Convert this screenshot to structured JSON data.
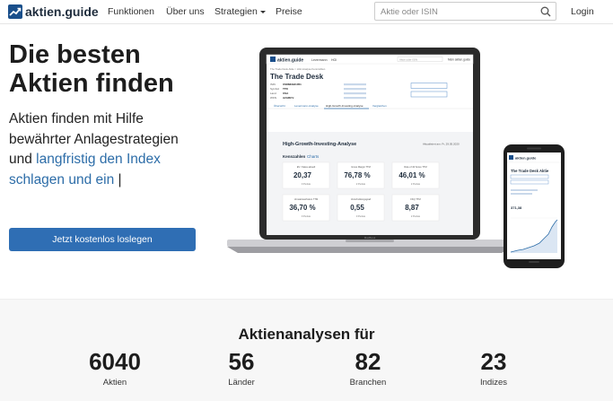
{
  "brand": {
    "name": "aktien.guide"
  },
  "nav": {
    "items": [
      {
        "label": "Funktionen"
      },
      {
        "label": "Über uns"
      },
      {
        "label": "Strategien"
      },
      {
        "label": "Preise"
      }
    ],
    "search_placeholder": "Aktie oder ISIN",
    "login": "Login"
  },
  "hero": {
    "title_line1": "Die besten",
    "title_line2": "Aktien finden",
    "sub_line1": "Aktien finden mit Hilfe",
    "sub_line2": "bewährter Anlagestrategien",
    "sub_line3a": "und ",
    "sub_line3b": "langfristig den Index",
    "sub_line4a": "schlagen und ein",
    "sub_line4b": " |",
    "cta": "Jetzt kostenlos loslegen"
  },
  "mockup": {
    "laptop": {
      "brand": "aktien.guide",
      "menu": [
        "Levermann",
        "HGI"
      ],
      "search": "Aktie oder ISIN",
      "account": "Mein aktien.guide",
      "breadcrumb": "The Trade Desk Aktie > HGI-Analyse Kennzahlen",
      "company": "The Trade Desk",
      "info_labels": [
        "ISIN",
        "Symbol",
        "Land",
        "WKN"
      ],
      "info_values": [
        "US88339J1051",
        "TTD",
        "USA",
        "A2ARCV"
      ],
      "tabs": [
        "Übersicht",
        "Levermann-Analyse",
        "High-Growth-Investing-Analyse",
        "Vergleichen"
      ],
      "section_title": "High-Growth-Investing-Analyse",
      "updated": "Aktualisiert am: Fr, 29.05.2020",
      "kennzahlen": "Kennzahlen",
      "charts": "Charts",
      "brand_label": "MacBook",
      "cards": [
        {
          "label": "EV / Sales aktuell",
          "value": "20,37",
          "points": "0 Punkte"
        },
        {
          "label": "Gross Margin TTM",
          "value": "76,78 %",
          "points": "2 Punkte"
        },
        {
          "label": "Rule of 40 Score TTM",
          "value": "46,01 %",
          "points": "2 Punkte"
        },
        {
          "label": "Umsatzwachstum TTM",
          "value": "36,70 %",
          "points": "0 Punkte"
        },
        {
          "label": "Verschuldungsgrad",
          "value": "0,55",
          "points": "0 Punkte"
        },
        {
          "label": "FKQ TTM",
          "value": "8,87",
          "points": "2 Punkte"
        }
      ]
    },
    "phone": {
      "brand": "aktien.guide",
      "title": "The Trade Desk Aktie",
      "price": "371,38"
    }
  },
  "stats": {
    "title": "Aktienanalysen für",
    "items": [
      {
        "value": "6040",
        "label": "Aktien"
      },
      {
        "value": "56",
        "label": "Länder"
      },
      {
        "value": "82",
        "label": "Branchen"
      },
      {
        "value": "23",
        "label": "Indizes"
      }
    ]
  },
  "colors": {
    "brand": "#1a4f8b",
    "cta": "#2f6eb4",
    "highlight": "#2d6da8"
  }
}
